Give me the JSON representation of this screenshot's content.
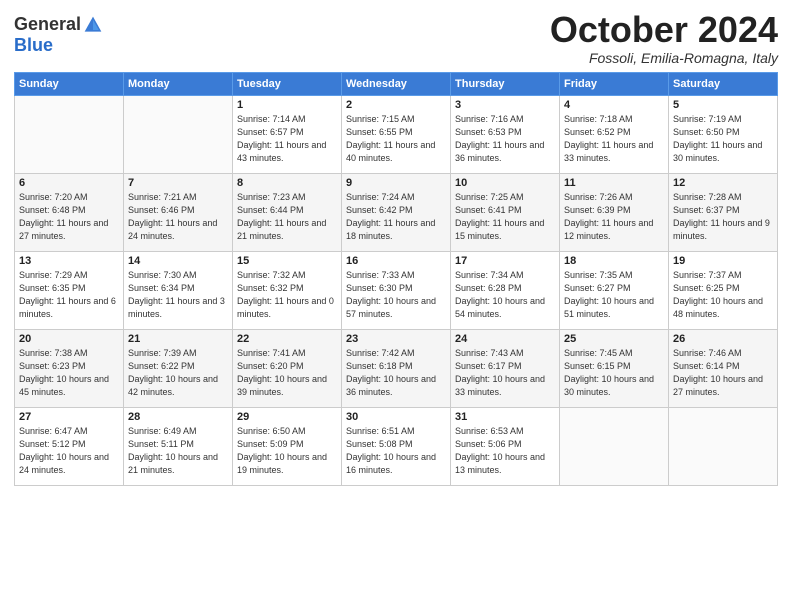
{
  "logo": {
    "general": "General",
    "blue": "Blue"
  },
  "header": {
    "month": "October 2024",
    "location": "Fossoli, Emilia-Romagna, Italy"
  },
  "weekdays": [
    "Sunday",
    "Monday",
    "Tuesday",
    "Wednesday",
    "Thursday",
    "Friday",
    "Saturday"
  ],
  "weeks": [
    [
      {
        "day": "",
        "info": ""
      },
      {
        "day": "",
        "info": ""
      },
      {
        "day": "1",
        "info": "Sunrise: 7:14 AM\nSunset: 6:57 PM\nDaylight: 11 hours and 43 minutes."
      },
      {
        "day": "2",
        "info": "Sunrise: 7:15 AM\nSunset: 6:55 PM\nDaylight: 11 hours and 40 minutes."
      },
      {
        "day": "3",
        "info": "Sunrise: 7:16 AM\nSunset: 6:53 PM\nDaylight: 11 hours and 36 minutes."
      },
      {
        "day": "4",
        "info": "Sunrise: 7:18 AM\nSunset: 6:52 PM\nDaylight: 11 hours and 33 minutes."
      },
      {
        "day": "5",
        "info": "Sunrise: 7:19 AM\nSunset: 6:50 PM\nDaylight: 11 hours and 30 minutes."
      }
    ],
    [
      {
        "day": "6",
        "info": "Sunrise: 7:20 AM\nSunset: 6:48 PM\nDaylight: 11 hours and 27 minutes."
      },
      {
        "day": "7",
        "info": "Sunrise: 7:21 AM\nSunset: 6:46 PM\nDaylight: 11 hours and 24 minutes."
      },
      {
        "day": "8",
        "info": "Sunrise: 7:23 AM\nSunset: 6:44 PM\nDaylight: 11 hours and 21 minutes."
      },
      {
        "day": "9",
        "info": "Sunrise: 7:24 AM\nSunset: 6:42 PM\nDaylight: 11 hours and 18 minutes."
      },
      {
        "day": "10",
        "info": "Sunrise: 7:25 AM\nSunset: 6:41 PM\nDaylight: 11 hours and 15 minutes."
      },
      {
        "day": "11",
        "info": "Sunrise: 7:26 AM\nSunset: 6:39 PM\nDaylight: 11 hours and 12 minutes."
      },
      {
        "day": "12",
        "info": "Sunrise: 7:28 AM\nSunset: 6:37 PM\nDaylight: 11 hours and 9 minutes."
      }
    ],
    [
      {
        "day": "13",
        "info": "Sunrise: 7:29 AM\nSunset: 6:35 PM\nDaylight: 11 hours and 6 minutes."
      },
      {
        "day": "14",
        "info": "Sunrise: 7:30 AM\nSunset: 6:34 PM\nDaylight: 11 hours and 3 minutes."
      },
      {
        "day": "15",
        "info": "Sunrise: 7:32 AM\nSunset: 6:32 PM\nDaylight: 11 hours and 0 minutes."
      },
      {
        "day": "16",
        "info": "Sunrise: 7:33 AM\nSunset: 6:30 PM\nDaylight: 10 hours and 57 minutes."
      },
      {
        "day": "17",
        "info": "Sunrise: 7:34 AM\nSunset: 6:28 PM\nDaylight: 10 hours and 54 minutes."
      },
      {
        "day": "18",
        "info": "Sunrise: 7:35 AM\nSunset: 6:27 PM\nDaylight: 10 hours and 51 minutes."
      },
      {
        "day": "19",
        "info": "Sunrise: 7:37 AM\nSunset: 6:25 PM\nDaylight: 10 hours and 48 minutes."
      }
    ],
    [
      {
        "day": "20",
        "info": "Sunrise: 7:38 AM\nSunset: 6:23 PM\nDaylight: 10 hours and 45 minutes."
      },
      {
        "day": "21",
        "info": "Sunrise: 7:39 AM\nSunset: 6:22 PM\nDaylight: 10 hours and 42 minutes."
      },
      {
        "day": "22",
        "info": "Sunrise: 7:41 AM\nSunset: 6:20 PM\nDaylight: 10 hours and 39 minutes."
      },
      {
        "day": "23",
        "info": "Sunrise: 7:42 AM\nSunset: 6:18 PM\nDaylight: 10 hours and 36 minutes."
      },
      {
        "day": "24",
        "info": "Sunrise: 7:43 AM\nSunset: 6:17 PM\nDaylight: 10 hours and 33 minutes."
      },
      {
        "day": "25",
        "info": "Sunrise: 7:45 AM\nSunset: 6:15 PM\nDaylight: 10 hours and 30 minutes."
      },
      {
        "day": "26",
        "info": "Sunrise: 7:46 AM\nSunset: 6:14 PM\nDaylight: 10 hours and 27 minutes."
      }
    ],
    [
      {
        "day": "27",
        "info": "Sunrise: 6:47 AM\nSunset: 5:12 PM\nDaylight: 10 hours and 24 minutes."
      },
      {
        "day": "28",
        "info": "Sunrise: 6:49 AM\nSunset: 5:11 PM\nDaylight: 10 hours and 21 minutes."
      },
      {
        "day": "29",
        "info": "Sunrise: 6:50 AM\nSunset: 5:09 PM\nDaylight: 10 hours and 19 minutes."
      },
      {
        "day": "30",
        "info": "Sunrise: 6:51 AM\nSunset: 5:08 PM\nDaylight: 10 hours and 16 minutes."
      },
      {
        "day": "31",
        "info": "Sunrise: 6:53 AM\nSunset: 5:06 PM\nDaylight: 10 hours and 13 minutes."
      },
      {
        "day": "",
        "info": ""
      },
      {
        "day": "",
        "info": ""
      }
    ]
  ]
}
